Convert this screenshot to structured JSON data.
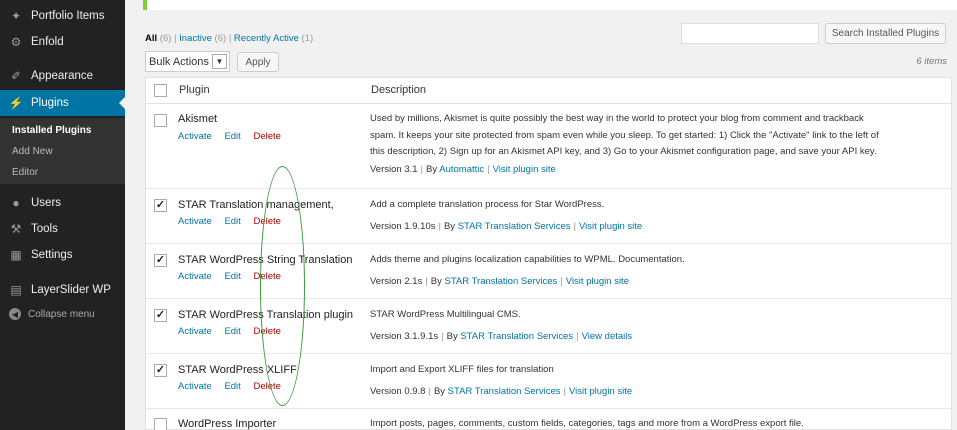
{
  "sidebar": {
    "items": [
      {
        "label": "Portfolio Items",
        "icon": "pin-icon"
      },
      {
        "label": "Enfold",
        "icon": "gear-icon"
      },
      {
        "label": "Appearance",
        "icon": "brush-icon"
      },
      {
        "label": "Plugins",
        "icon": "plug-icon"
      },
      {
        "label": "Users",
        "icon": "user-icon"
      },
      {
        "label": "Tools",
        "icon": "wrench-icon"
      },
      {
        "label": "Settings",
        "icon": "settings-icon"
      },
      {
        "label": "LayerSlider WP",
        "icon": "layers-icon"
      }
    ],
    "submenu": [
      "Installed Plugins",
      "Add New",
      "Editor"
    ],
    "collapse_label": "Collapse menu"
  },
  "filters": {
    "all_label": "All",
    "all_count": "(6)",
    "inactive_label": "Inactive",
    "inactive_count": "(6)",
    "recent_label": "Recently Active",
    "recent_count": "(1)",
    "separator": "|"
  },
  "search": {
    "button_label": "Search Installed Plugins",
    "value": ""
  },
  "bulk": {
    "selected": "Bulk Actions",
    "apply_label": "Apply"
  },
  "items_count": "6 items",
  "table": {
    "col_plugin": "Plugin",
    "col_description": "Description",
    "action_labels": {
      "activate": "Activate",
      "edit": "Edit",
      "delete": "Delete"
    },
    "rows": [
      {
        "name": "Akismet",
        "checked": false,
        "desc_lines": [
          "Used by millions, Akismet is quite possibly the best way in the world to protect your blog from comment and trackback",
          "spam. It keeps your site protected from spam even while you sleep. To get started: 1) Click the \"Activate\" link to the left of",
          "this description, 2) Sign up for an Akismet API key, and 3) Go to your Akismet configuration page, and save your API key."
        ],
        "version": "Version 3.1",
        "by": "By",
        "author": "Automattic",
        "link": "Visit plugin site"
      },
      {
        "name": "STAR Translation management,",
        "checked": true,
        "desc_lines": [
          "Add a complete translation process for Star WordPress."
        ],
        "version": "Version 1.9.10s",
        "by": "By",
        "author": "STAR Translation Services",
        "link": "Visit plugin site"
      },
      {
        "name": "STAR WordPress String Translation",
        "checked": true,
        "desc_lines": [
          "Adds theme and plugins localization capabilities to WPML. Documentation."
        ],
        "version": "Version 2.1s",
        "by": "By",
        "author": "STAR Translation Services",
        "link": "Visit plugin site"
      },
      {
        "name": "STAR WordPress Translation plugin",
        "checked": true,
        "desc_lines": [
          "STAR WordPress Multilingual CMS."
        ],
        "version": "Version 3.1.9.1s",
        "by": "By",
        "author": "STAR Translation Services",
        "link": "View details"
      },
      {
        "name": "STAR WordPress XLIFF",
        "checked": true,
        "desc_lines": [
          "Import and Export XLIFF files for translation"
        ],
        "version": "Version 0.9.8",
        "by": "By",
        "author": "STAR Translation Services",
        "link": "Visit plugin site"
      },
      {
        "name": "WordPress Importer",
        "checked": false,
        "desc_lines": [
          "Import posts, pages, comments, custom fields, categories, tags and more from a WordPress export file."
        ]
      }
    ]
  },
  "colors": {
    "accent": "#0074a2",
    "sidebar_bg": "#222222",
    "delete": "#aa0000",
    "highlight_oval": "#3c9a3c"
  }
}
